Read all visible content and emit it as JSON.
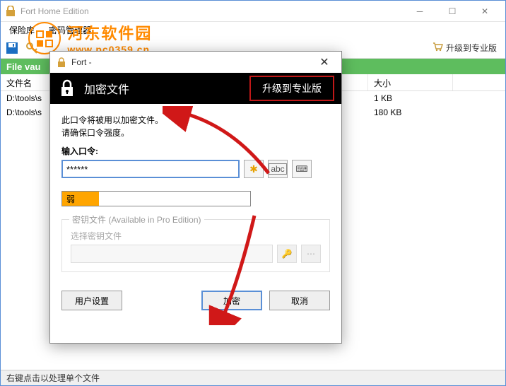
{
  "main": {
    "title": "Fort Home Edition",
    "menu": {
      "vault": "保险库",
      "pwmgr": "密码管理器"
    },
    "upgrade": "升级到专业版",
    "vault_header": "File vau",
    "columns": {
      "name": "文件名",
      "size": "大小"
    },
    "rows": [
      {
        "name": "D:\\tools\\s",
        "size": "1 KB"
      },
      {
        "name": "D:\\tools\\s",
        "size": "180 KB"
      }
    ],
    "statusbar": "右键点击以处理单个文件"
  },
  "watermark": {
    "cn": "河东软件园",
    "url": "www.pc0359.cn"
  },
  "dialog": {
    "title": "Fort -",
    "header_title": "加密文件",
    "header_upgrade": "升级到专业版",
    "instr1": "此口令将被用以加密文件。",
    "instr2": "请确保口令强度。",
    "pw_label": "输入口令:",
    "pw_value": "******",
    "strength_label": "弱",
    "keyfile_legend": "密钥文件 (Available in Pro Edition)",
    "keyfile_label": "选择密钥文件",
    "btn_user_settings": "用户设置",
    "btn_encrypt": "加密",
    "btn_cancel": "取消",
    "aux_star": "✱",
    "aux_abc": "abc",
    "aux_kb": "⌨"
  }
}
